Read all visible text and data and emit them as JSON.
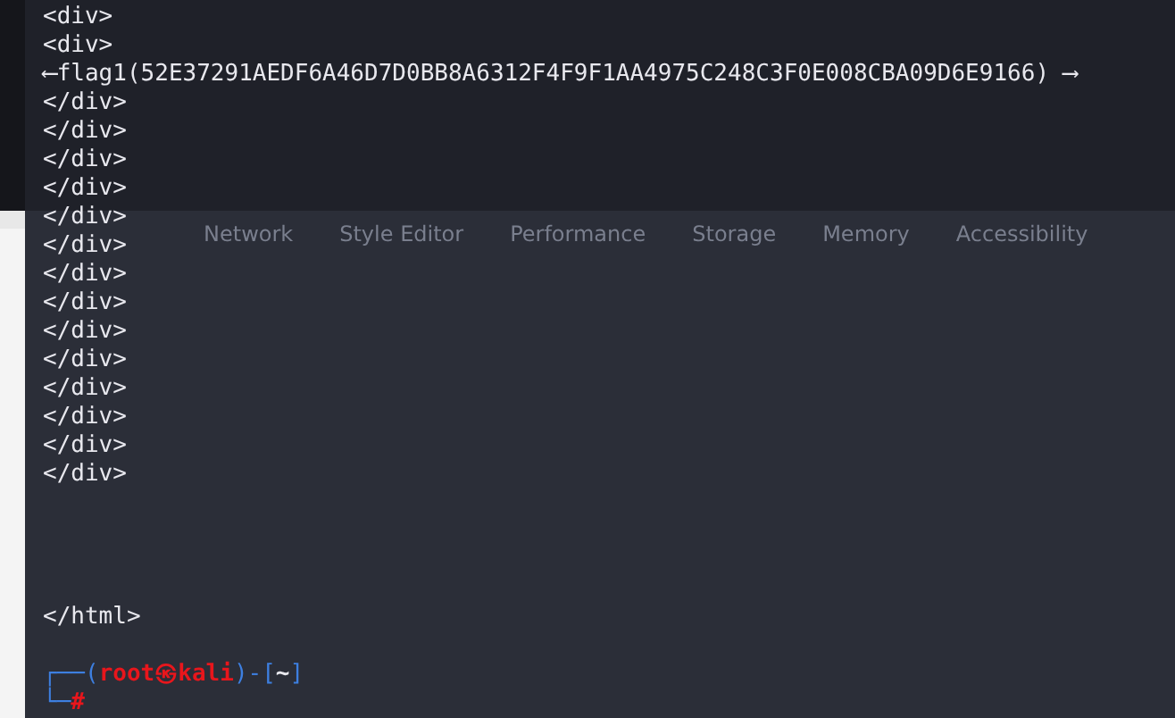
{
  "devtools_tabs": [
    "Network",
    "Style Editor",
    "Performance",
    "Storage",
    "Memory",
    "Accessibility"
  ],
  "terminal": {
    "output": [
      "<div>",
      "<div>",
      "⟵flag1(52E37291AEDF6A46D7D0BB8A6312F4F9F1AA4975C248C3F0E008CBA09D6E9166) ⟶",
      "</div>",
      "</div>",
      "</div>",
      "</div>",
      "</div>",
      "</div>",
      "</div>",
      "</div>",
      "</div>",
      "</div>",
      "</div>",
      "</div>",
      "</div>",
      "</div>"
    ],
    "closing": "</html>",
    "prompt": [
      [
        {
          "kind": "frame",
          "text": "┌──("
        },
        {
          "kind": "user",
          "text": "root㉿kali"
        },
        {
          "kind": "frame",
          "text": ")-["
        },
        {
          "kind": "dir",
          "text": "~"
        },
        {
          "kind": "frame",
          "text": "]"
        }
      ],
      [
        {
          "kind": "frame",
          "text": "└─"
        },
        {
          "kind": "user",
          "text": "#"
        }
      ]
    ]
  }
}
